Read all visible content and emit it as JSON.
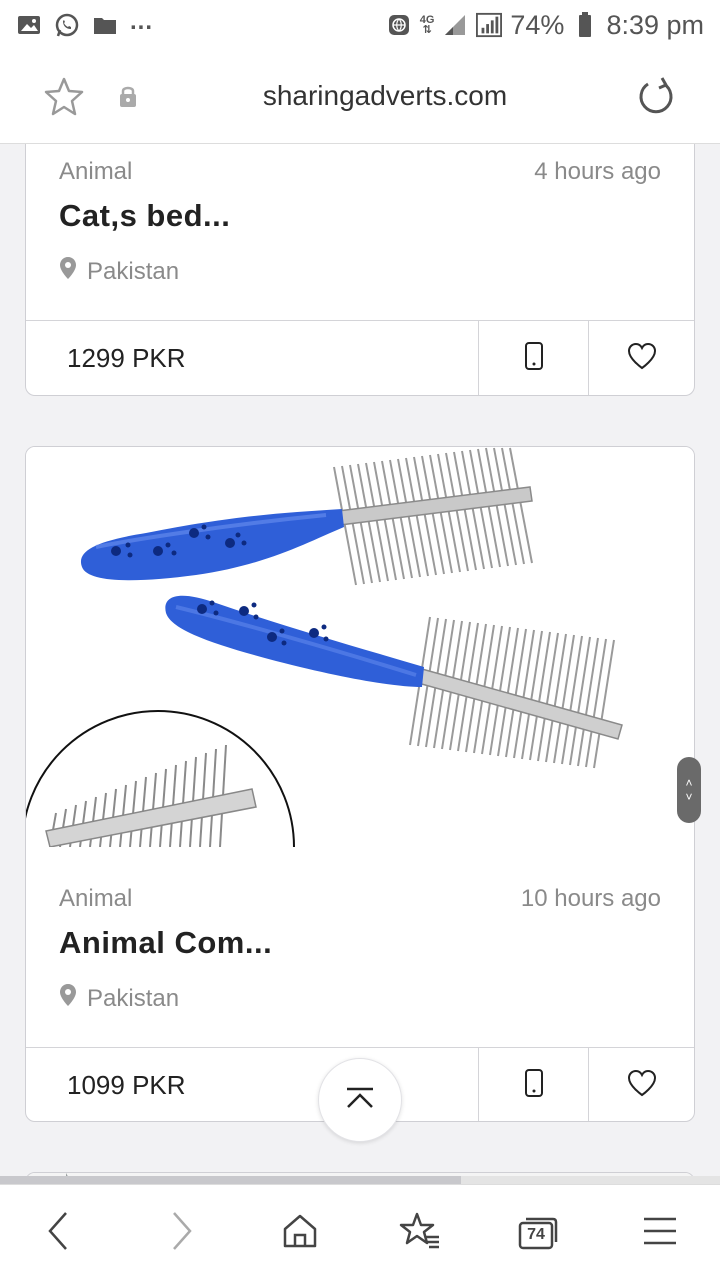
{
  "status_bar": {
    "left_icons": [
      "image-icon",
      "whatsapp-icon",
      "folder-icon"
    ],
    "more": "...",
    "network": "4G",
    "battery": "74%",
    "time": "8:39 pm"
  },
  "address_bar": {
    "url": "sharingadverts.com"
  },
  "listings": [
    {
      "category": "Animal",
      "time_ago": "4 hours ago",
      "title": "Cat,s bed...",
      "location": "Pakistan",
      "price": "1299 PKR"
    },
    {
      "category": "Animal",
      "time_ago": "10 hours ago",
      "title": "Animal Com...",
      "location": "Pakistan",
      "price": "1099 PKR"
    }
  ],
  "page_progress": 0.64,
  "bottom_nav": {
    "tabs_count": "74"
  },
  "colors": {
    "accent_blue": "#2f5fd8",
    "text_gray": "#8a8a8a"
  }
}
